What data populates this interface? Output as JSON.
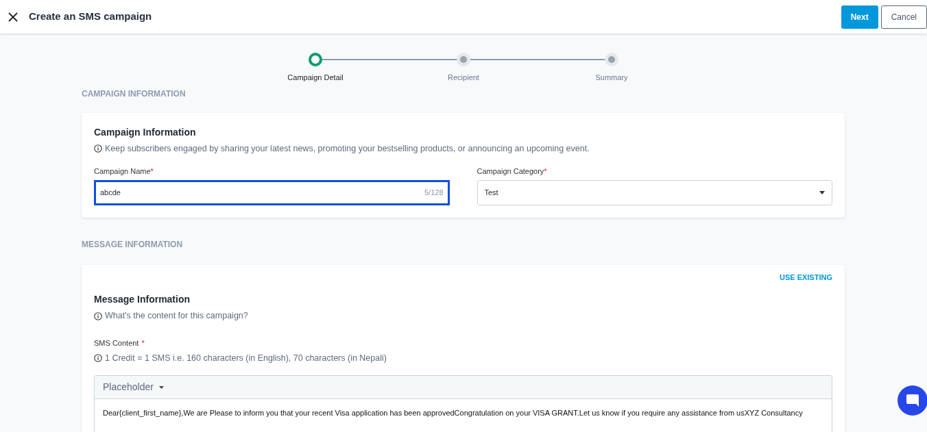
{
  "header": {
    "title": "Create an SMS campaign",
    "buttons": [
      {
        "label": "Next",
        "kind": "primary"
      },
      {
        "label": "Cancel",
        "kind": "outline"
      }
    ]
  },
  "stepper": [
    {
      "label": "Campaign Detail",
      "selected": true
    },
    {
      "label": "Recipient",
      "selected": false
    },
    {
      "label": "Summary",
      "selected": false
    }
  ],
  "campaign_section": {
    "heading": "CAMPAIGN INFORMATION",
    "card_title": "Campaign Information",
    "hint": "Keep subscribers engaged by sharing your latest news, promoting your bestselling products, or announcing an upcoming event.",
    "name_field": {
      "label": "Campaign Name",
      "required_mark": "*",
      "value": "abcde",
      "counter": "5/128",
      "focused": true
    },
    "category_field": {
      "label": "Campaign Category",
      "required_mark": "*",
      "value": "Test"
    }
  },
  "message_section": {
    "heading": "MESSAGE INFORMATION",
    "link": "USE EXISTING",
    "card_title": "Message Information",
    "hint": "What's the content for this campaign?",
    "content_label": "SMS Content",
    "required_mark": "*",
    "credit_hint": "1 Credit = 1 SMS i.e. 160 characters (in English), 70 characters (in Nepali)",
    "placeholder_menu": "Placeholder",
    "message": "Dear{client_first_name},We are Please to inform you that your recent Visa application has been approvedCongratulation on your VISA GRANT.Let us know if you require any assistance from usXYZ Consultancy"
  }
}
